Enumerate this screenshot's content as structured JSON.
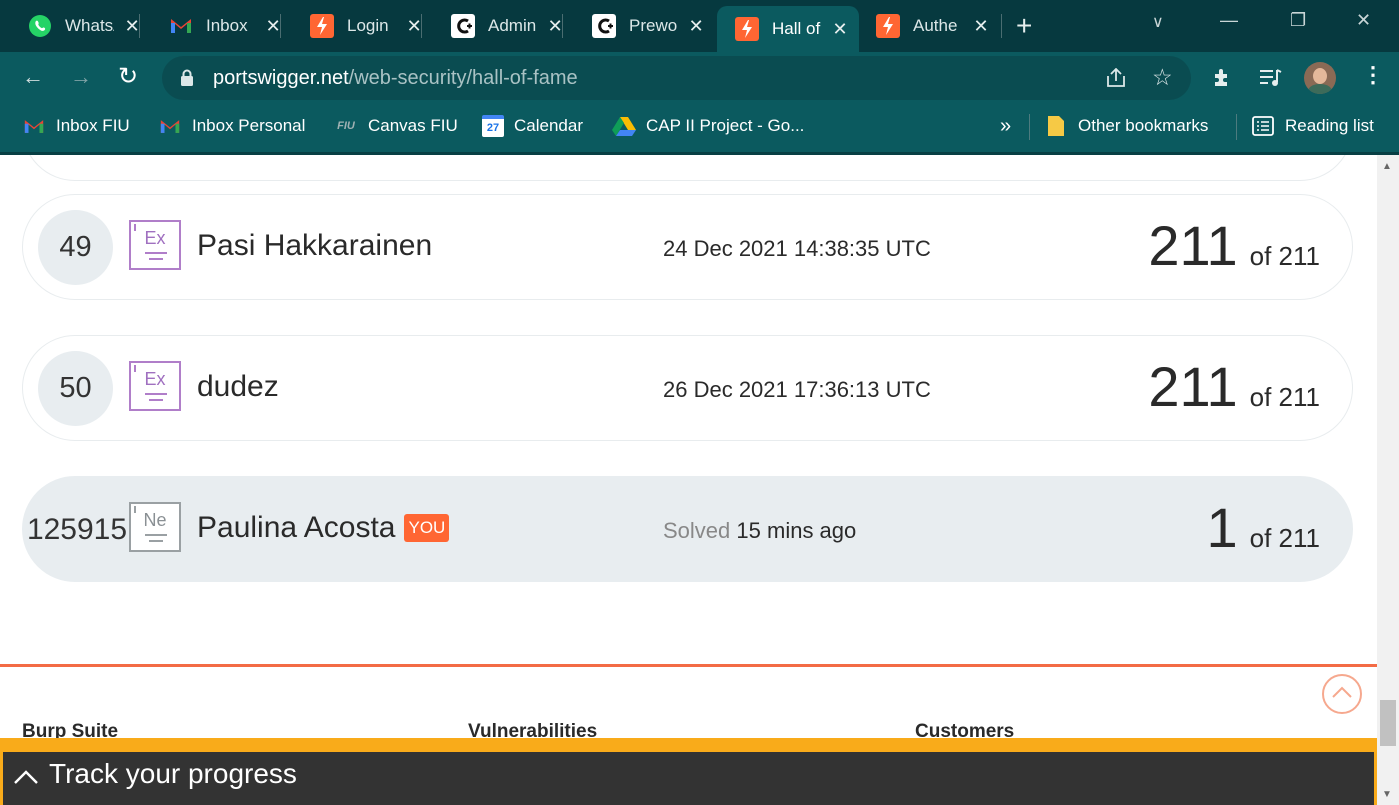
{
  "tabs": [
    {
      "title": "WhatsApp",
      "icon": "whatsapp-icon",
      "close": "✕"
    },
    {
      "title": "Inbox",
      "icon": "gmail-icon",
      "close": "✕"
    },
    {
      "title": "Login",
      "icon": "portswigger-icon",
      "close": "✕"
    },
    {
      "title": "Admin",
      "icon": "lab-icon",
      "close": "✕"
    },
    {
      "title": "Prewo",
      "icon": "lab-icon",
      "close": "✕"
    },
    {
      "title": "Hall of",
      "icon": "portswigger-icon",
      "close": "✕",
      "active": true
    },
    {
      "title": "Authe",
      "icon": "portswigger-icon",
      "close": "✕"
    }
  ],
  "address_bar": {
    "host": "portswigger.net",
    "path": "/web-security/hall-of-fame"
  },
  "bookmarks": [
    {
      "label": "Inbox FIU",
      "icon": "gmail-icon"
    },
    {
      "label": "Inbox Personal",
      "icon": "gmail-icon"
    },
    {
      "label": "Canvas FIU",
      "icon": "fiu-icon",
      "icon_text": "FIU"
    },
    {
      "label": "Calendar",
      "icon": "calendar-icon",
      "icon_text": "27"
    },
    {
      "label": "CAP II Project - Go...",
      "icon": "drive-icon"
    }
  ],
  "bookmarks_overflow": "»",
  "other_bookmarks": "Other bookmarks",
  "reading_list": "Reading list",
  "leaderboard": [
    {
      "rank": "49",
      "level": "Ex",
      "name": "Pasi Hakkarainen",
      "date": "24 Dec 2021 14:38:35 UTC",
      "solved": "211",
      "total": "of 211"
    },
    {
      "rank": "50",
      "level": "Ex",
      "name": "dudez",
      "date": "26 Dec 2021 17:36:13 UTC",
      "solved": "211",
      "total": "of 211"
    }
  ],
  "current_user": {
    "rank": "125915",
    "level": "Ne",
    "name": "Paulina Acosta",
    "you_label": "YOU",
    "solved_prefix": "Solved",
    "solved_time": "15 mins ago",
    "solved": "1",
    "total": "of 211"
  },
  "footer": {
    "columns": [
      "Burp Suite",
      "Vulnerabilities",
      "Customers"
    ]
  },
  "progress_bar": {
    "label": "Track your progress"
  },
  "colors": {
    "accent": "#ff6633",
    "tab_bar": "#06393f",
    "toolbar": "#0b5a5f",
    "progress": "#f9ab1a"
  }
}
